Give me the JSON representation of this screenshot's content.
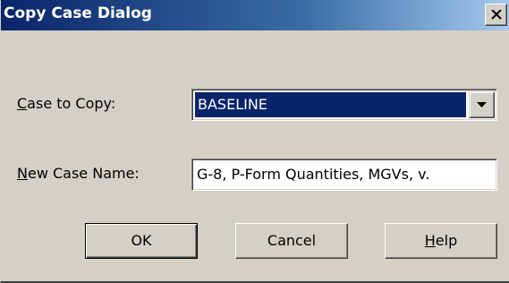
{
  "window": {
    "title": "Copy Case Dialog",
    "close_icon": "close-icon"
  },
  "case_to_copy": {
    "label_mnemonic": "C",
    "label_rest": "ase to Copy:",
    "selected_value": "BASELINE",
    "dropdown_icon": "chevron-down-icon"
  },
  "new_case_name": {
    "label_mnemonic": "N",
    "label_rest": "ew Case Name:",
    "value": "G-8, P-Form Quantities, MGVs, v."
  },
  "buttons": {
    "ok": "OK",
    "cancel": "Cancel",
    "help_mnemonic": "H",
    "help_rest": "elp"
  },
  "colors": {
    "title_bar": "#0a246a",
    "dialog_face": "#d4d0c8",
    "selection": "#0a246a"
  }
}
